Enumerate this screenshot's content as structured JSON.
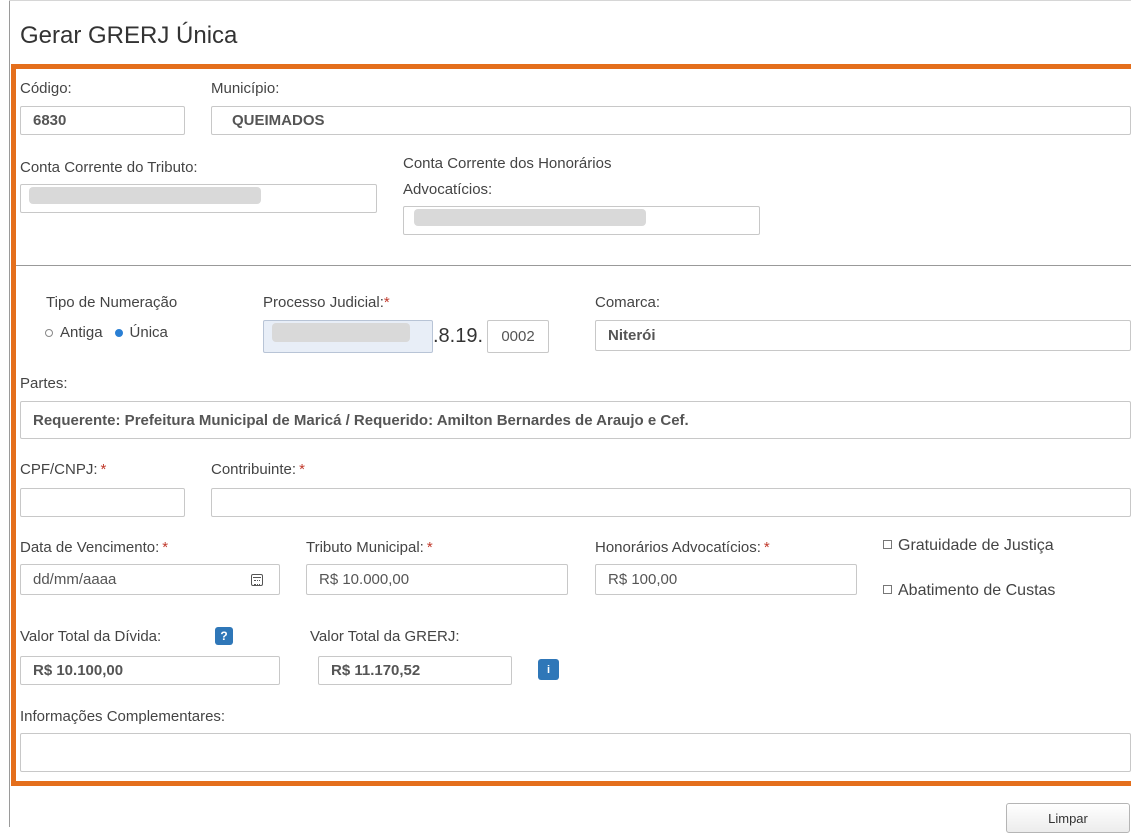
{
  "page": {
    "title": "Gerar GRERJ Única"
  },
  "form": {
    "codigo": {
      "label": "Código:",
      "value": "6830"
    },
    "municipio": {
      "label": "Município:",
      "value": "QUEIMADOS"
    },
    "conta_tributo": {
      "label": "Conta Corrente do Tributo:"
    },
    "conta_honorarios": {
      "label_line1": "Conta Corrente dos Honorários",
      "label_line2": "Advocatícios:"
    },
    "tipo_numeracao": {
      "label": "Tipo de Numeração",
      "options": [
        {
          "label": "Antiga",
          "selected": false
        },
        {
          "label": "Única",
          "selected": true
        }
      ]
    },
    "processo": {
      "label": "Processo Judicial:",
      "required_mark": "*",
      "middle": ".8.19.",
      "suffix": "0002"
    },
    "comarca": {
      "label": "Comarca:",
      "value": "Niterói"
    },
    "partes": {
      "label": "Partes:",
      "value": "Requerente: Prefeitura Municipal de Maricá / Requerido: Amilton Bernardes de Araujo e Cef."
    },
    "cpf": {
      "label": "CPF/CNPJ:",
      "required_mark": "*",
      "value": ""
    },
    "contribuinte": {
      "label": "Contribuinte:",
      "required_mark": "*",
      "value": ""
    },
    "data_vencimento": {
      "label": "Data de Vencimento:",
      "required_mark": "*",
      "placeholder": "dd/mm/aaaa",
      "icon": "calendar-icon"
    },
    "tributo": {
      "label": "Tributo Municipal:",
      "required_mark": "*",
      "value": "R$ 10.000,00"
    },
    "honorarios": {
      "label": "Honorários Advocatícios:",
      "required_mark": "*",
      "value": "R$ 100,00"
    },
    "gratuidade": {
      "label": "Gratuidade de Justiça",
      "checked": false
    },
    "abatimento": {
      "label": "Abatimento de Custas",
      "checked": false
    },
    "valor_total_divida": {
      "label": "Valor Total da Dívida:",
      "help_glyph": "?",
      "value": "R$ 10.100,00"
    },
    "valor_total_grerj": {
      "label": "Valor Total da GRERJ:",
      "value": "R$ 11.170,52",
      "info_glyph": "i"
    },
    "informacoes": {
      "label": "Informações Complementares:",
      "value": ""
    }
  },
  "actions": {
    "limpar_label": "Limpar"
  },
  "colors": {
    "highlight": "#e46f1c",
    "required": "#c0392b",
    "info_button": "#2f77b8",
    "radio_selected": "#2a7fd4"
  }
}
